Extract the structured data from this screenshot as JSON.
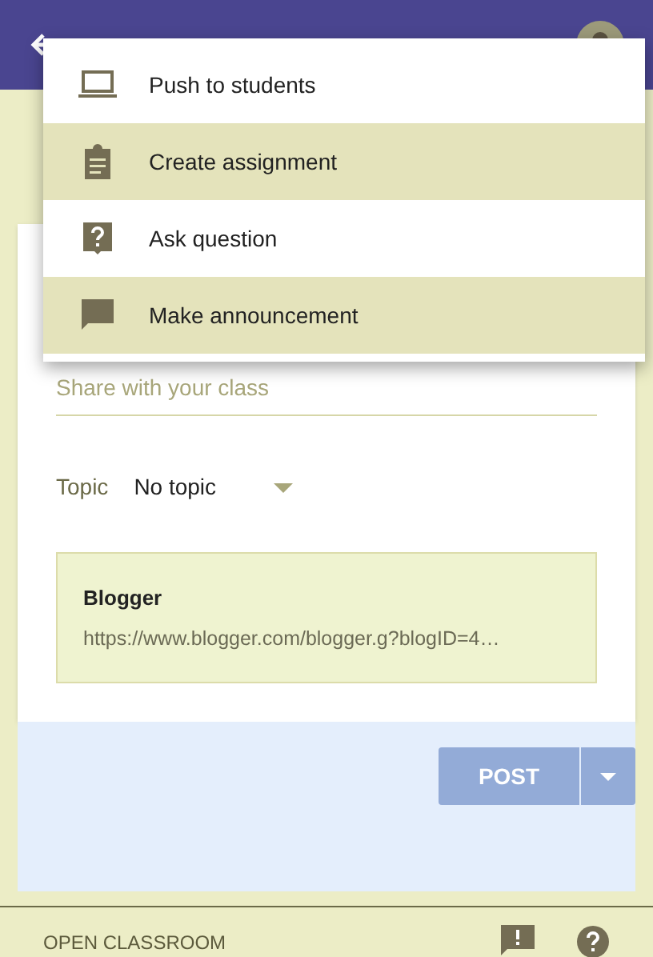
{
  "menu": [
    {
      "kind": "laptop",
      "label": "Push to students",
      "selected": false
    },
    {
      "kind": "clipboard",
      "label": "Create assignment",
      "selected": true
    },
    {
      "kind": "question",
      "label": "Ask question",
      "selected": false
    },
    {
      "kind": "chat",
      "label": "Make announcement",
      "selected": true
    }
  ],
  "post_form": {
    "placeholder": "Share with your class",
    "topic_label": "Topic",
    "topic_value": "No topic",
    "attachment": {
      "title": "Blogger",
      "url": "https://www.blogger.com/blogger.g?blogID=4…"
    },
    "post_button": "POST"
  },
  "footer": {
    "link": "OPEN CLASSROOM"
  }
}
